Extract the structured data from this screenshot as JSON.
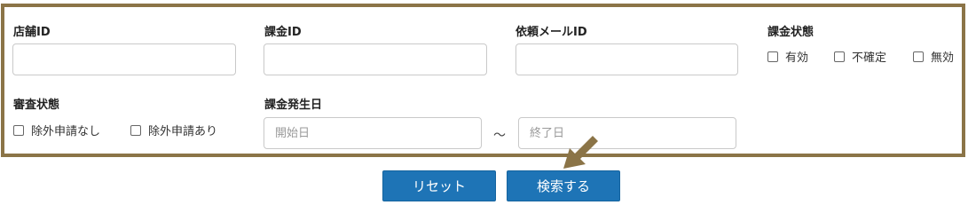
{
  "form": {
    "store_id_label": "店舗ID",
    "billing_id_label": "課金ID",
    "request_mail_id_label": "依頼メールID",
    "billing_status": {
      "label": "課金状態",
      "options": [
        "有効",
        "不確定",
        "無効"
      ]
    },
    "review_status": {
      "label": "審査状態",
      "options": [
        "除外申請なし",
        "除外申請あり"
      ]
    },
    "billing_date": {
      "label": "課金発生日",
      "start_placeholder": "開始日",
      "separator": "～",
      "end_placeholder": "終了日"
    }
  },
  "buttons": {
    "reset_label": "リセット",
    "search_label": "検索する"
  },
  "colors": {
    "panel_border": "#8b7447",
    "button_bg": "#1e74b6",
    "cursor_arrow": "#8b7447"
  },
  "icons": {
    "cursor": "arrow-cursor-icon"
  }
}
